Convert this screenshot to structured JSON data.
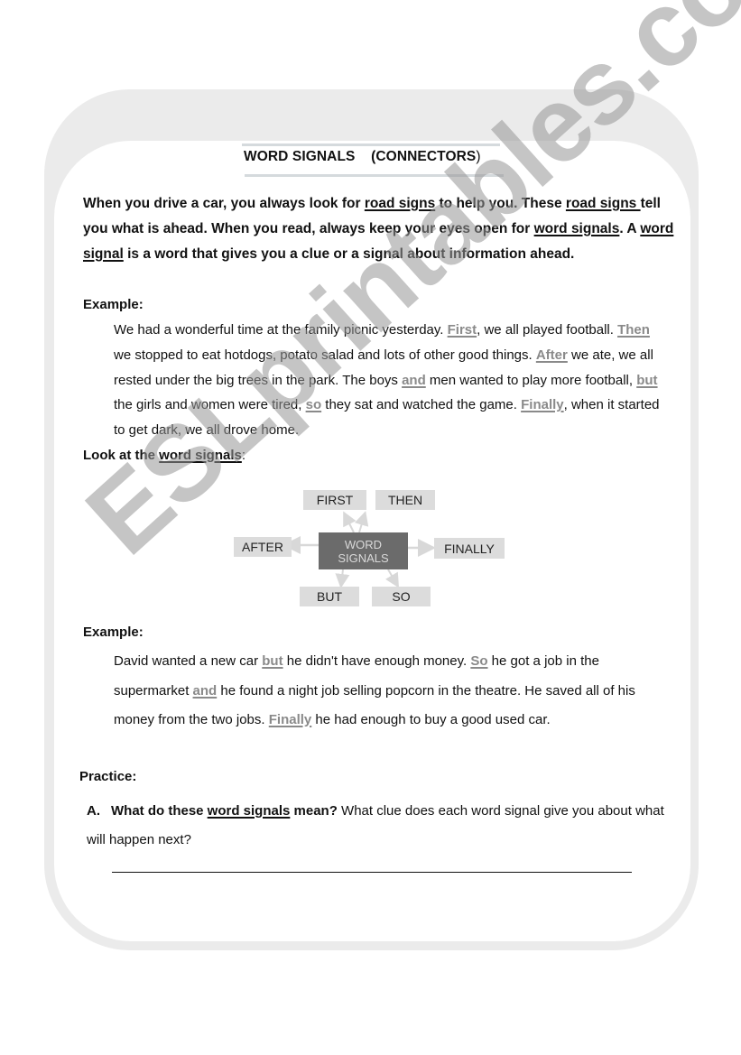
{
  "document": {
    "title_main": "WORD SIGNALS",
    "title_paren_open": "(CONNECTORS",
    "title_paren_close": ")",
    "intro": {
      "s1_a": "When you drive a car, you always look for ",
      "s1_u": "road signs",
      "s1_b": " to help you.  These ",
      "s2_u": "road signs ",
      "s2_b": "tell you what is ahead.  When you read, always keep your eyes open for ",
      "s3_u": "word signals",
      "s3_b": ".  A ",
      "s4_u": "word signal",
      "s4_b": " is a word that gives you a clue or a signal about information ahead."
    },
    "example1_label": "Example:",
    "example1": {
      "t1": "We had a wonderful time at the family picnic yesterday. ",
      "w1": "First",
      "t2": ", we all played football. ",
      "w2": "Then",
      "t3": " we stopped to eat hotdogs, potato salad and lots of other good things.  ",
      "w3": "After",
      "t4": " we ate, we all rested under the big trees in the park.  The boys ",
      "w4": "and",
      "t5": " men wanted to play more football, ",
      "w5": "but",
      "t6": " the girls and women were tired, ",
      "w6": "so",
      "t7": " they sat and watched the game.  ",
      "w7": "Finally",
      "t8": ", when it started to get dark, we all drove home."
    },
    "look_label_a": "Look at the ",
    "look_label_u": "word signals",
    "look_label_b": ":",
    "diagram": {
      "center_line1": "WORD",
      "center_line2": "SIGNALS",
      "first": "FIRST",
      "then": "THEN",
      "after": "AFTER",
      "finally": "FINALLY",
      "but": "BUT",
      "so": "SO"
    },
    "example2_label": "Example:",
    "example2": {
      "t1": "David wanted a new car ",
      "w1": "but",
      "t2": " he didn't have enough money.  ",
      "w2": "So",
      "t3": " he got a job in the supermarket ",
      "w3": "and",
      "t4": " he found a night job selling popcorn in the theatre.  He saved all of his money from the two jobs.  ",
      "w4": "Finally",
      "t5": " he had enough to buy a good used car."
    },
    "practice_label": "Practice:",
    "question_a": {
      "letter": "A.",
      "bold_a": "What do these ",
      "bold_u": "word signals",
      "bold_b": " mean?",
      "rest": "  What clue does each word signal give you about what will happen next?"
    },
    "watermark": "ESLprintables.com"
  }
}
